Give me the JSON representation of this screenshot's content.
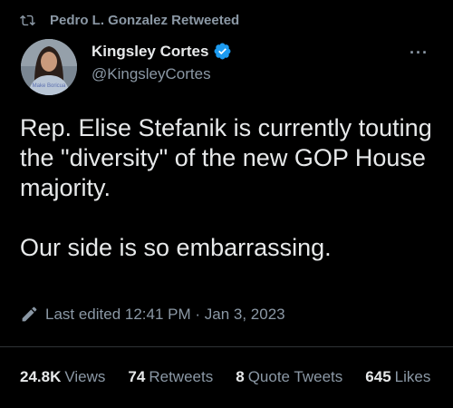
{
  "retweet": {
    "text": "Pedro L. Gonzalez Retweeted",
    "icon": "retweet-icon"
  },
  "author": {
    "name": "Kingsley Cortes",
    "handle": "@KingsleyCortes",
    "verified": true,
    "verified_color": "#1d9bf0",
    "avatar_shirt_text": "Make Boricua"
  },
  "more_label": "···",
  "tweet": {
    "paragraphs": [
      "Rep. Elise Stefanik is currently touting the \"diversity\" of the new GOP House majority.",
      "Our side is so embarrassing."
    ]
  },
  "edited": {
    "label": "Last edited 12:41 PM · Jan 3, 2023",
    "icon": "edit-pencil-icon"
  },
  "stats": {
    "views": {
      "count": "24.8K",
      "label": "Views"
    },
    "retweets": {
      "count": "74",
      "label": "Retweets"
    },
    "quote_tweets": {
      "count": "8",
      "label": "Quote Tweets"
    },
    "likes": {
      "count": "645",
      "label": "Likes"
    }
  },
  "colors": {
    "background": "#000000",
    "text_primary": "#e7e9ea",
    "text_secondary": "#8b98a5",
    "divider": "#2f3336"
  }
}
